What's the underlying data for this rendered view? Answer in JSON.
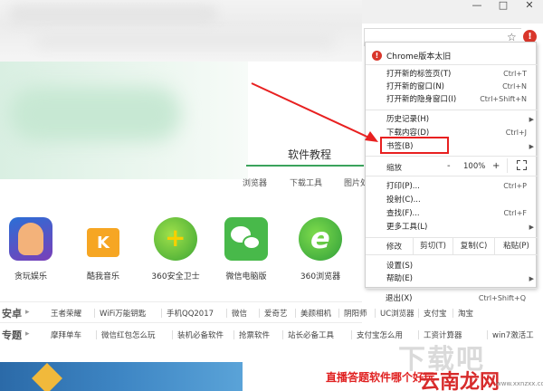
{
  "window": {
    "controls": [
      "—",
      "□",
      "✕"
    ]
  },
  "toolbar": {
    "star_icon": "star-icon",
    "menu_icon": "chrome-menu-warning-icon"
  },
  "page": {
    "tab_heading": "软件教程",
    "subtabs": [
      "浏览器",
      "下载工具",
      "图片处"
    ],
    "apps": [
      {
        "label": "贪玩娱乐",
        "icon": "game-icon"
      },
      {
        "label": "酷我音乐",
        "icon": "kuwo-icon"
      },
      {
        "label": "360安全卫士",
        "icon": "360-safe-icon"
      },
      {
        "label": "微信电脑版",
        "icon": "wechat-icon"
      },
      {
        "label": "360浏览器",
        "icon": "360-browser-icon"
      }
    ],
    "row_android": {
      "category": "安卓",
      "tags": [
        "王者荣耀",
        "WiFi万能钥匙",
        "手机QQ2017",
        "微信",
        "爱奇艺",
        "美颜相机",
        "阴阳师",
        "UC浏览器",
        "支付宝",
        "淘宝"
      ]
    },
    "row_topics": {
      "category": "专题",
      "tags": [
        "摩拜单车",
        "微信红包怎么玩",
        "装机必备软件",
        "抢票软件",
        "站长必备工具",
        "支付宝怎么用",
        "工资计算器",
        "win7激活工"
      ]
    },
    "red_caption": "直播答题软件哪个好玩",
    "watermark_big": "下载吧",
    "watermark_brand": "云南龙网",
    "watermark_url": "www.xxnzxx.com"
  },
  "menu": {
    "update_warning": "Chrome版本太旧",
    "items_group1": [
      {
        "label": "打开新的标签页(T)",
        "shortcut": "Ctrl+T"
      },
      {
        "label": "打开新的窗口(N)",
        "shortcut": "Ctrl+N"
      },
      {
        "label": "打开新的隐身窗口(I)",
        "shortcut": "Ctrl+Shift+N"
      }
    ],
    "items_group2": [
      {
        "label": "历史记录(H)",
        "shortcut": "",
        "submenu": true
      },
      {
        "label": "下载内容(D)",
        "shortcut": "Ctrl+J",
        "submenu": false
      },
      {
        "label": "书签(B)",
        "shortcut": "",
        "submenu": true
      }
    ],
    "zoom": {
      "label": "缩放",
      "minus": "-",
      "value": "100%",
      "plus": "+"
    },
    "items_group3": [
      {
        "label": "打印(P)...",
        "shortcut": "Ctrl+P",
        "submenu": false
      },
      {
        "label": "投射(C)...",
        "shortcut": "",
        "submenu": false
      },
      {
        "label": "查找(F)...",
        "shortcut": "Ctrl+F",
        "submenu": false
      },
      {
        "label": "更多工具(L)",
        "shortcut": "",
        "submenu": true
      }
    ],
    "edit": {
      "label": "修改",
      "cut": "剪切(T)",
      "copy": "复制(C)",
      "paste": "粘贴(P)"
    },
    "items_group4": [
      {
        "label": "设置(S)",
        "shortcut": "",
        "submenu": false
      },
      {
        "label": "帮助(E)",
        "shortcut": "",
        "submenu": true
      }
    ],
    "exit": {
      "label": "退出(X)",
      "shortcut": "Ctrl+Shift+Q"
    }
  },
  "colors": {
    "accent_green": "#3aa35c",
    "highlight_red": "#e82020",
    "menu_warning": "#d9362b"
  }
}
